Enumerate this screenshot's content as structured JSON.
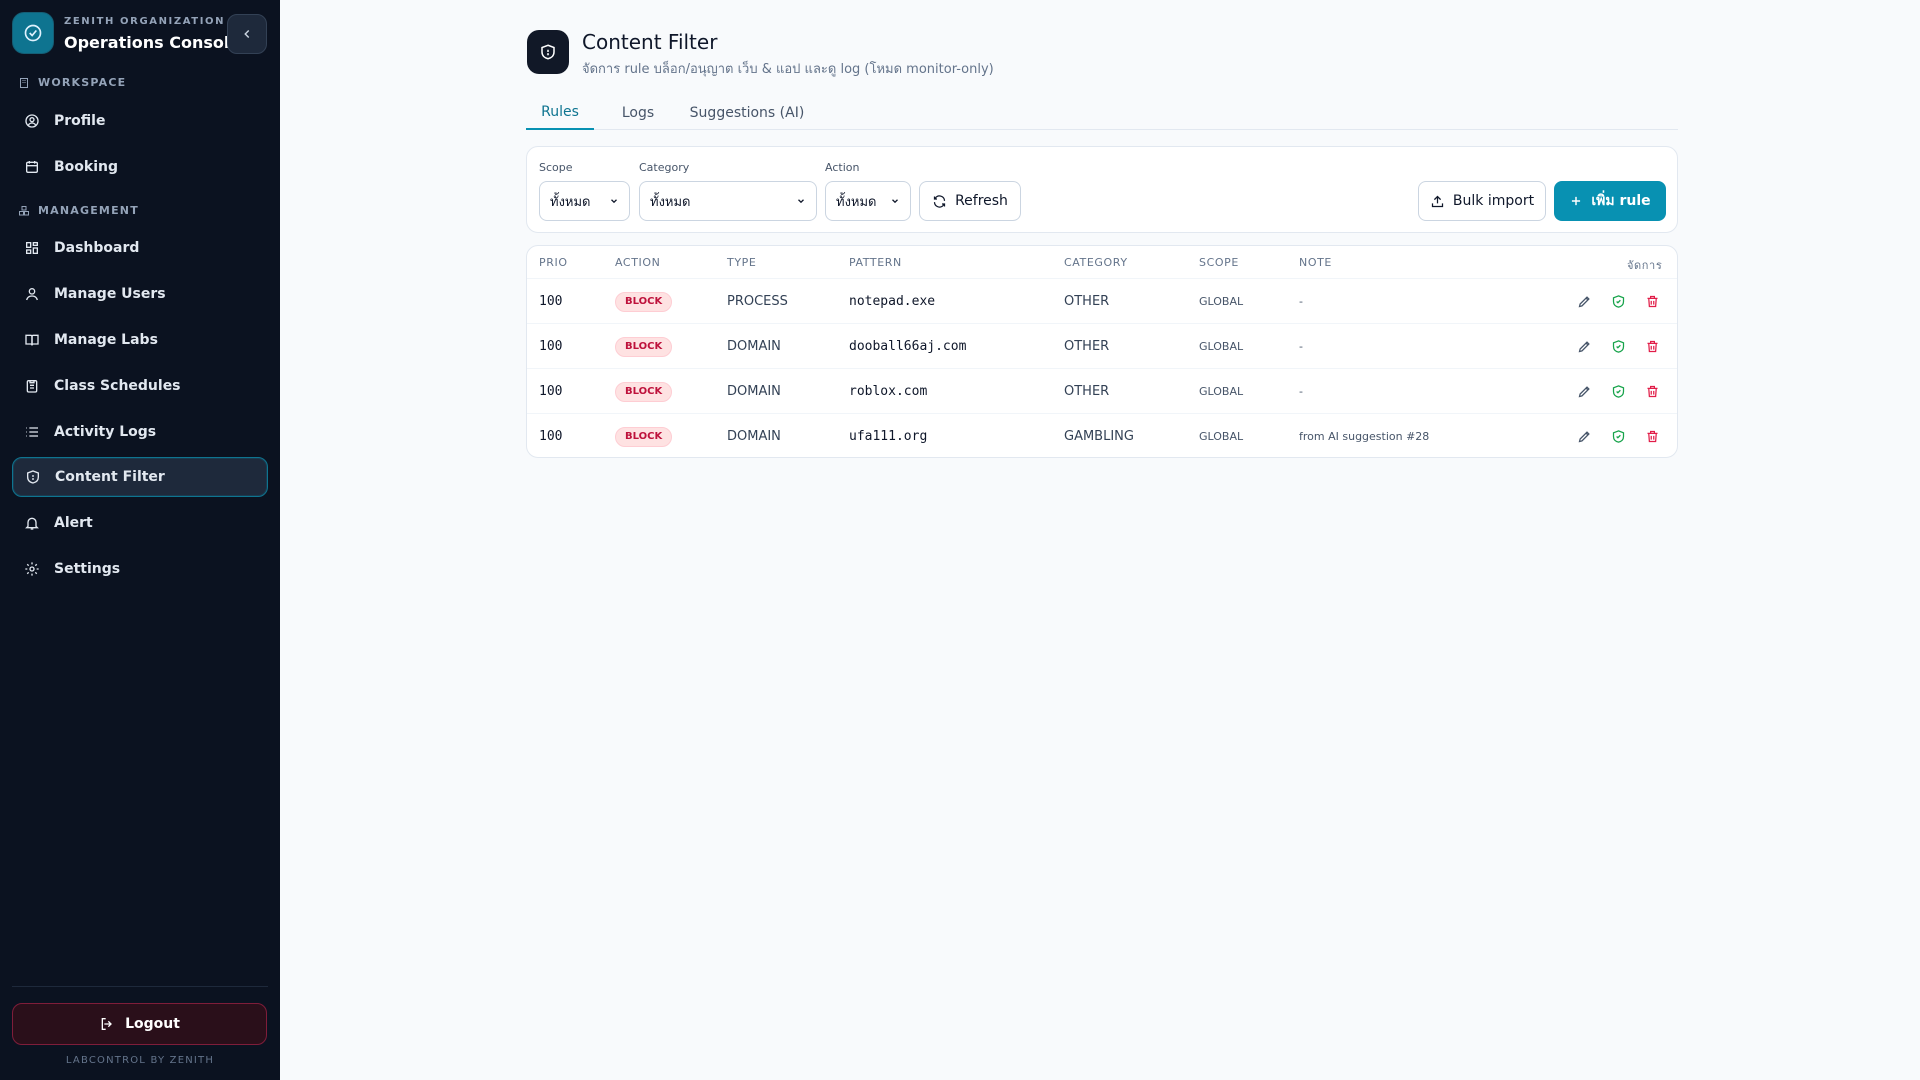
{
  "sidebar": {
    "org": "ZENITH ORGANIZATION",
    "title": "Operations Console",
    "sections": [
      {
        "label": "WORKSPACE"
      },
      {
        "label": "MANAGEMENT"
      }
    ],
    "items": [
      {
        "label": "Profile",
        "icon": "user-circle-icon"
      },
      {
        "label": "Booking",
        "icon": "calendar-icon"
      },
      {
        "label": "Dashboard",
        "icon": "grid-icon"
      },
      {
        "label": "Manage Users",
        "icon": "user-icon"
      },
      {
        "label": "Manage Labs",
        "icon": "book-icon"
      },
      {
        "label": "Class Schedules",
        "icon": "clipboard-icon"
      },
      {
        "label": "Activity Logs",
        "icon": "list-icon"
      },
      {
        "label": "Content Filter",
        "icon": "shield-icon",
        "active": true
      },
      {
        "label": "Alert",
        "icon": "bell-icon"
      },
      {
        "label": "Settings",
        "icon": "gear-icon"
      }
    ],
    "logout_label": "Logout",
    "footer": "LABCONTROL BY ZENITH"
  },
  "page": {
    "title": "Content Filter",
    "subtitle": "จัดการ rule บล็อก/อนุญาต เว็บ & แอป และดู log (โหมด monitor-only)"
  },
  "tabs": [
    {
      "label": "Rules",
      "active": true
    },
    {
      "label": "Logs"
    },
    {
      "label": "Suggestions (AI)"
    }
  ],
  "filters": {
    "scope": {
      "label": "Scope",
      "value": "ทั้งหมด"
    },
    "category": {
      "label": "Category",
      "value": "ทั้งหมด"
    },
    "action": {
      "label": "Action",
      "value": "ทั้งหมด"
    },
    "refresh_label": "Refresh",
    "bulk_import_label": "Bulk import",
    "add_rule_label": "เพิ่ม rule"
  },
  "table": {
    "headers": {
      "prio": "PRIO",
      "action": "ACTION",
      "type": "TYPE",
      "pattern": "PATTERN",
      "category": "CATEGORY",
      "scope": "SCOPE",
      "note": "NOTE",
      "manage": "จัดการ"
    },
    "rows": [
      {
        "prio": "100",
        "action": "BLOCK",
        "type": "PROCESS",
        "pattern": "notepad.exe",
        "category": "OTHER",
        "scope": "GLOBAL",
        "note": "-"
      },
      {
        "prio": "100",
        "action": "BLOCK",
        "type": "DOMAIN",
        "pattern": "dooball66aj.com",
        "category": "OTHER",
        "scope": "GLOBAL",
        "note": "-"
      },
      {
        "prio": "100",
        "action": "BLOCK",
        "type": "DOMAIN",
        "pattern": "roblox.com",
        "category": "OTHER",
        "scope": "GLOBAL",
        "note": "-"
      },
      {
        "prio": "100",
        "action": "BLOCK",
        "type": "DOMAIN",
        "pattern": "ufa111.org",
        "category": "GAMBLING",
        "scope": "GLOBAL",
        "note": "from AI suggestion #28"
      }
    ]
  },
  "colors": {
    "sidebar_bg": "#0b1220",
    "accent": "#0891b2",
    "block_badge": "#be123c",
    "approve_icon": "#16a34a",
    "delete_icon": "#e11d48"
  }
}
